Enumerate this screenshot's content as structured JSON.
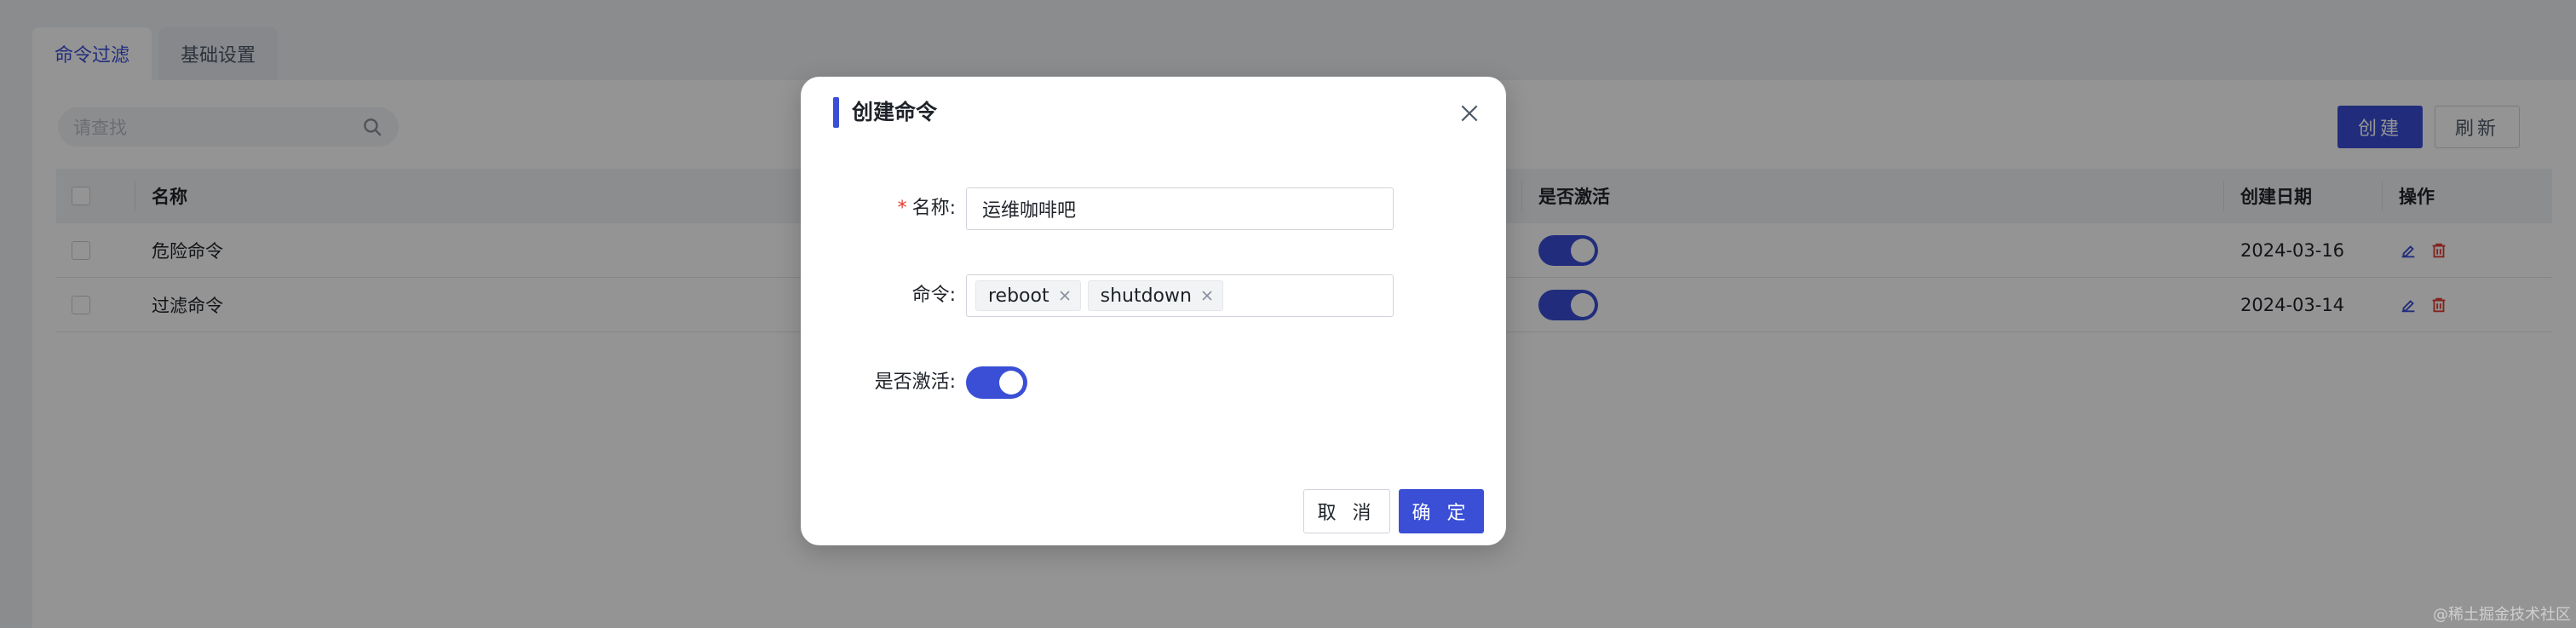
{
  "tabs": [
    {
      "label": "命令过滤",
      "active": true
    },
    {
      "label": "基础设置",
      "active": false
    }
  ],
  "search": {
    "placeholder": "请查找"
  },
  "toolbar": {
    "create_label": "创建",
    "refresh_label": "刷新"
  },
  "table": {
    "headers": {
      "name": "名称",
      "active": "是否激活",
      "created": "创建日期",
      "actions": "操作"
    },
    "rows": [
      {
        "name": "危险命令",
        "active": true,
        "created": "2024-03-16"
      },
      {
        "name": "过滤命令",
        "active": true,
        "created": "2024-03-14"
      }
    ]
  },
  "modal": {
    "title": "创建命令",
    "name_label": "名称",
    "name_value": "运维咖啡吧",
    "command_label": "命令",
    "commands": [
      "reboot",
      "shutdown"
    ],
    "active_label": "是否激活",
    "active_value": true,
    "cancel_label": "取 消",
    "ok_label": "确 定"
  },
  "watermark": "@稀土掘金技术社区",
  "colors": {
    "primary": "#3a4fd6",
    "danger": "#e23a2f"
  }
}
